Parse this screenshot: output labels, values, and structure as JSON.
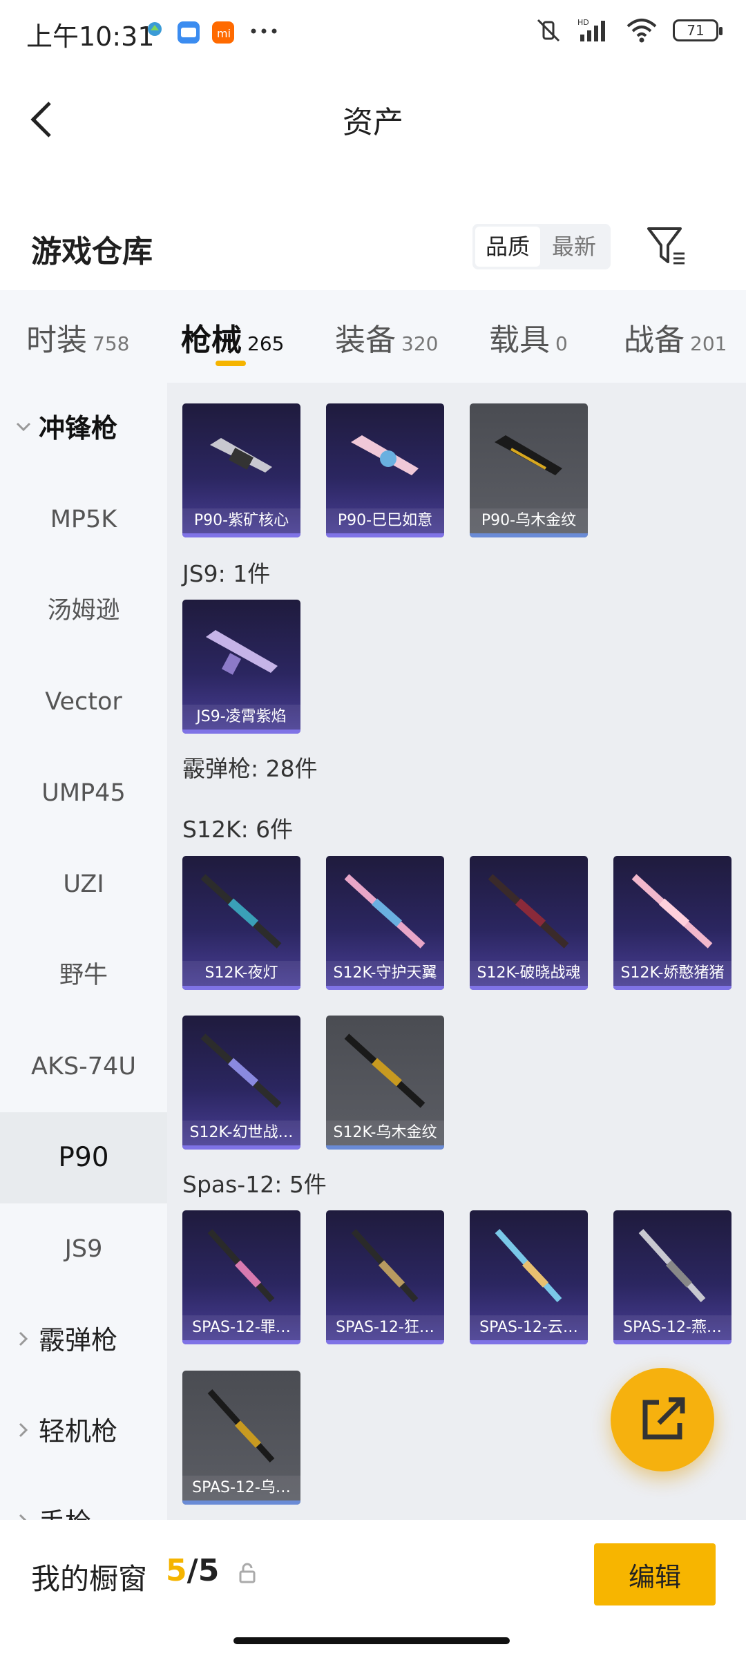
{
  "status": {
    "time": "上午10:31",
    "battery": "71"
  },
  "header": {
    "title": "资产"
  },
  "section": {
    "title": "游戏仓库",
    "sort_quality": "品质",
    "sort_newest": "最新"
  },
  "tabs": [
    {
      "label": "时装",
      "count": "758"
    },
    {
      "label": "枪械",
      "count": "265"
    },
    {
      "label": "装备",
      "count": "320"
    },
    {
      "label": "载具",
      "count": "0"
    },
    {
      "label": "战备",
      "count": "201"
    }
  ],
  "sidebar": {
    "group_open": "冲锋枪",
    "items": [
      "MP5K",
      "汤姆逊",
      "Vector",
      "UMP45",
      "UZI",
      "野牛",
      "AKS-74U",
      "P90",
      "JS9"
    ],
    "group_shotgun": "霰弹枪",
    "group_lmg": "轻机枪",
    "group_pistol": "手枪"
  },
  "content": {
    "p90_cards": [
      "P90-紫矿核心",
      "P90-巳巳如意",
      "P90-乌木金纹"
    ],
    "js9_title": "JS9: 1件",
    "js9_cards": [
      "JS9-凌霄紫焰"
    ],
    "shotgun_title": "霰弹枪: 28件",
    "s12k_title": "S12K: 6件",
    "s12k_cards": [
      "S12K-夜灯",
      "S12K-守护天翼",
      "S12K-破晓战魂",
      "S12K-娇憨猪猪",
      "S12K-幻世战…",
      "S12K-乌木金纹"
    ],
    "spas_title": "Spas-12: 5件",
    "spas_cards": [
      "SPAS-12-罪…",
      "SPAS-12-狂…",
      "SPAS-12-云…",
      "SPAS-12-燕…",
      "SPAS-12-乌…"
    ]
  },
  "bottom": {
    "title": "我的橱窗",
    "current": "5",
    "sep": "/",
    "total": "5",
    "edit": "编辑"
  },
  "colors": {
    "accent": "#f5b400",
    "card_purple": "#2b2660",
    "card_gray": "#5c5e65"
  },
  "icons": [
    "back-icon",
    "filter-icon",
    "share-icon",
    "lock-icon",
    "chevron-down-icon",
    "chevron-right-icon"
  ]
}
